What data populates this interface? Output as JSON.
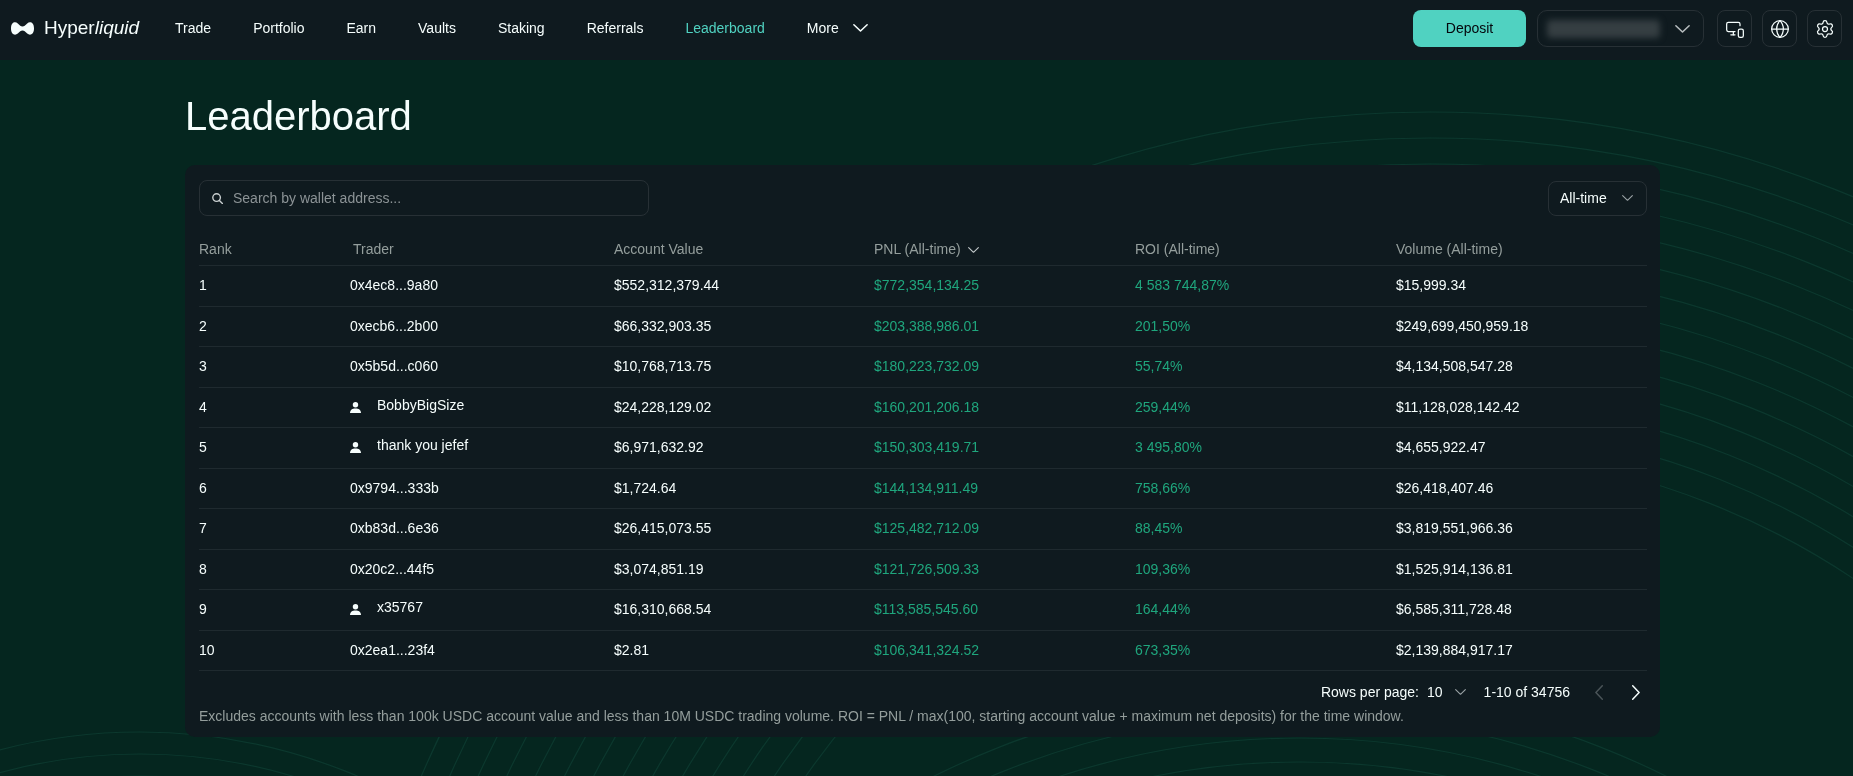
{
  "nav": {
    "logo": [
      {
        "text": "Hyper",
        "italic": false
      },
      {
        "text": "liquid",
        "italic": true
      }
    ],
    "items": [
      {
        "label": "Trade",
        "selected": false,
        "kind": "link"
      },
      {
        "label": "Portfolio",
        "selected": false,
        "kind": "link"
      },
      {
        "label": "Earn",
        "selected": false,
        "kind": "link"
      },
      {
        "label": "Vaults",
        "selected": false,
        "kind": "link"
      },
      {
        "label": "Staking",
        "selected": false,
        "kind": "link"
      },
      {
        "label": "Referrals",
        "selected": false,
        "kind": "link"
      },
      {
        "label": "Leaderboard",
        "selected": true,
        "kind": "link"
      },
      {
        "label": "More",
        "selected": false,
        "kind": "menu"
      }
    ],
    "deposit": "Deposit"
  },
  "page": {
    "title": "Leaderboard"
  },
  "leaderboard": {
    "search": {
      "placeholder": "Search by wallet address..."
    },
    "period": {
      "value": "All-time"
    },
    "columns": [
      {
        "label": "Rank",
        "sorted": false
      },
      {
        "label": "Trader",
        "sorted": false
      },
      {
        "label": "Account Value",
        "sorted": false
      },
      {
        "label": "PNL (All-time)",
        "sorted": true
      },
      {
        "label": "ROI (All-time)",
        "sorted": false
      },
      {
        "label": "Volume (All-time)",
        "sorted": false
      }
    ],
    "rows": [
      {
        "rank": "1",
        "trader": "0x4ec8...9a80",
        "kind": "address",
        "account_value": "$552,312,379.44",
        "pnl": "$772,354,134.25",
        "roi": "4 583 744,87%",
        "volume": "$15,999.34"
      },
      {
        "rank": "2",
        "trader": "0xecb6...2b00",
        "kind": "address",
        "account_value": "$66,332,903.35",
        "pnl": "$203,388,986.01",
        "roi": "201,50%",
        "volume": "$249,699,450,959.18"
      },
      {
        "rank": "3",
        "trader": "0x5b5d...c060",
        "kind": "address",
        "account_value": "$10,768,713.75",
        "pnl": "$180,223,732.09",
        "roi": "55,74%",
        "volume": "$4,134,508,547.28"
      },
      {
        "rank": "4",
        "trader": "BobbyBigSize",
        "kind": "user",
        "account_value": "$24,228,129.02",
        "pnl": "$160,201,206.18",
        "roi": "259,44%",
        "volume": "$11,128,028,142.42"
      },
      {
        "rank": "5",
        "trader": "thank you jefef",
        "kind": "user",
        "account_value": "$6,971,632.92",
        "pnl": "$150,303,419.71",
        "roi": "3 495,80%",
        "volume": "$4,655,922.47"
      },
      {
        "rank": "6",
        "trader": "0x9794...333b",
        "kind": "address",
        "account_value": "$1,724.64",
        "pnl": "$144,134,911.49",
        "roi": "758,66%",
        "volume": "$26,418,407.46"
      },
      {
        "rank": "7",
        "trader": "0xb83d...6e36",
        "kind": "address",
        "account_value": "$26,415,073.55",
        "pnl": "$125,482,712.09",
        "roi": "88,45%",
        "volume": "$3,819,551,966.36"
      },
      {
        "rank": "8",
        "trader": "0x20c2...44f5",
        "kind": "address",
        "account_value": "$3,074,851.19",
        "pnl": "$121,726,509.33",
        "roi": "109,36%",
        "volume": "$1,525,914,136.81"
      },
      {
        "rank": "9",
        "trader": "x35767",
        "kind": "user",
        "account_value": "$16,310,668.54",
        "pnl": "$113,585,545.60",
        "roi": "164,44%",
        "volume": "$6,585,311,728.48"
      },
      {
        "rank": "10",
        "trader": "0x2ea1...23f4",
        "kind": "address",
        "account_value": "$2.81",
        "pnl": "$106,341,324.52",
        "roi": "673,35%",
        "volume": "$2,139,884,917.17"
      }
    ],
    "pagination": {
      "label": "Rows per page:",
      "rows_per_page": "10",
      "range": "1-10 of 34756",
      "prev": {
        "disabled": true
      },
      "next": {
        "disabled": false
      }
    },
    "note": "Excludes accounts with less than 100k USDC account value and less than 10M USDC trading volume. ROI = PNL / max(100, starting account value + maximum net deposits) for the time window."
  }
}
